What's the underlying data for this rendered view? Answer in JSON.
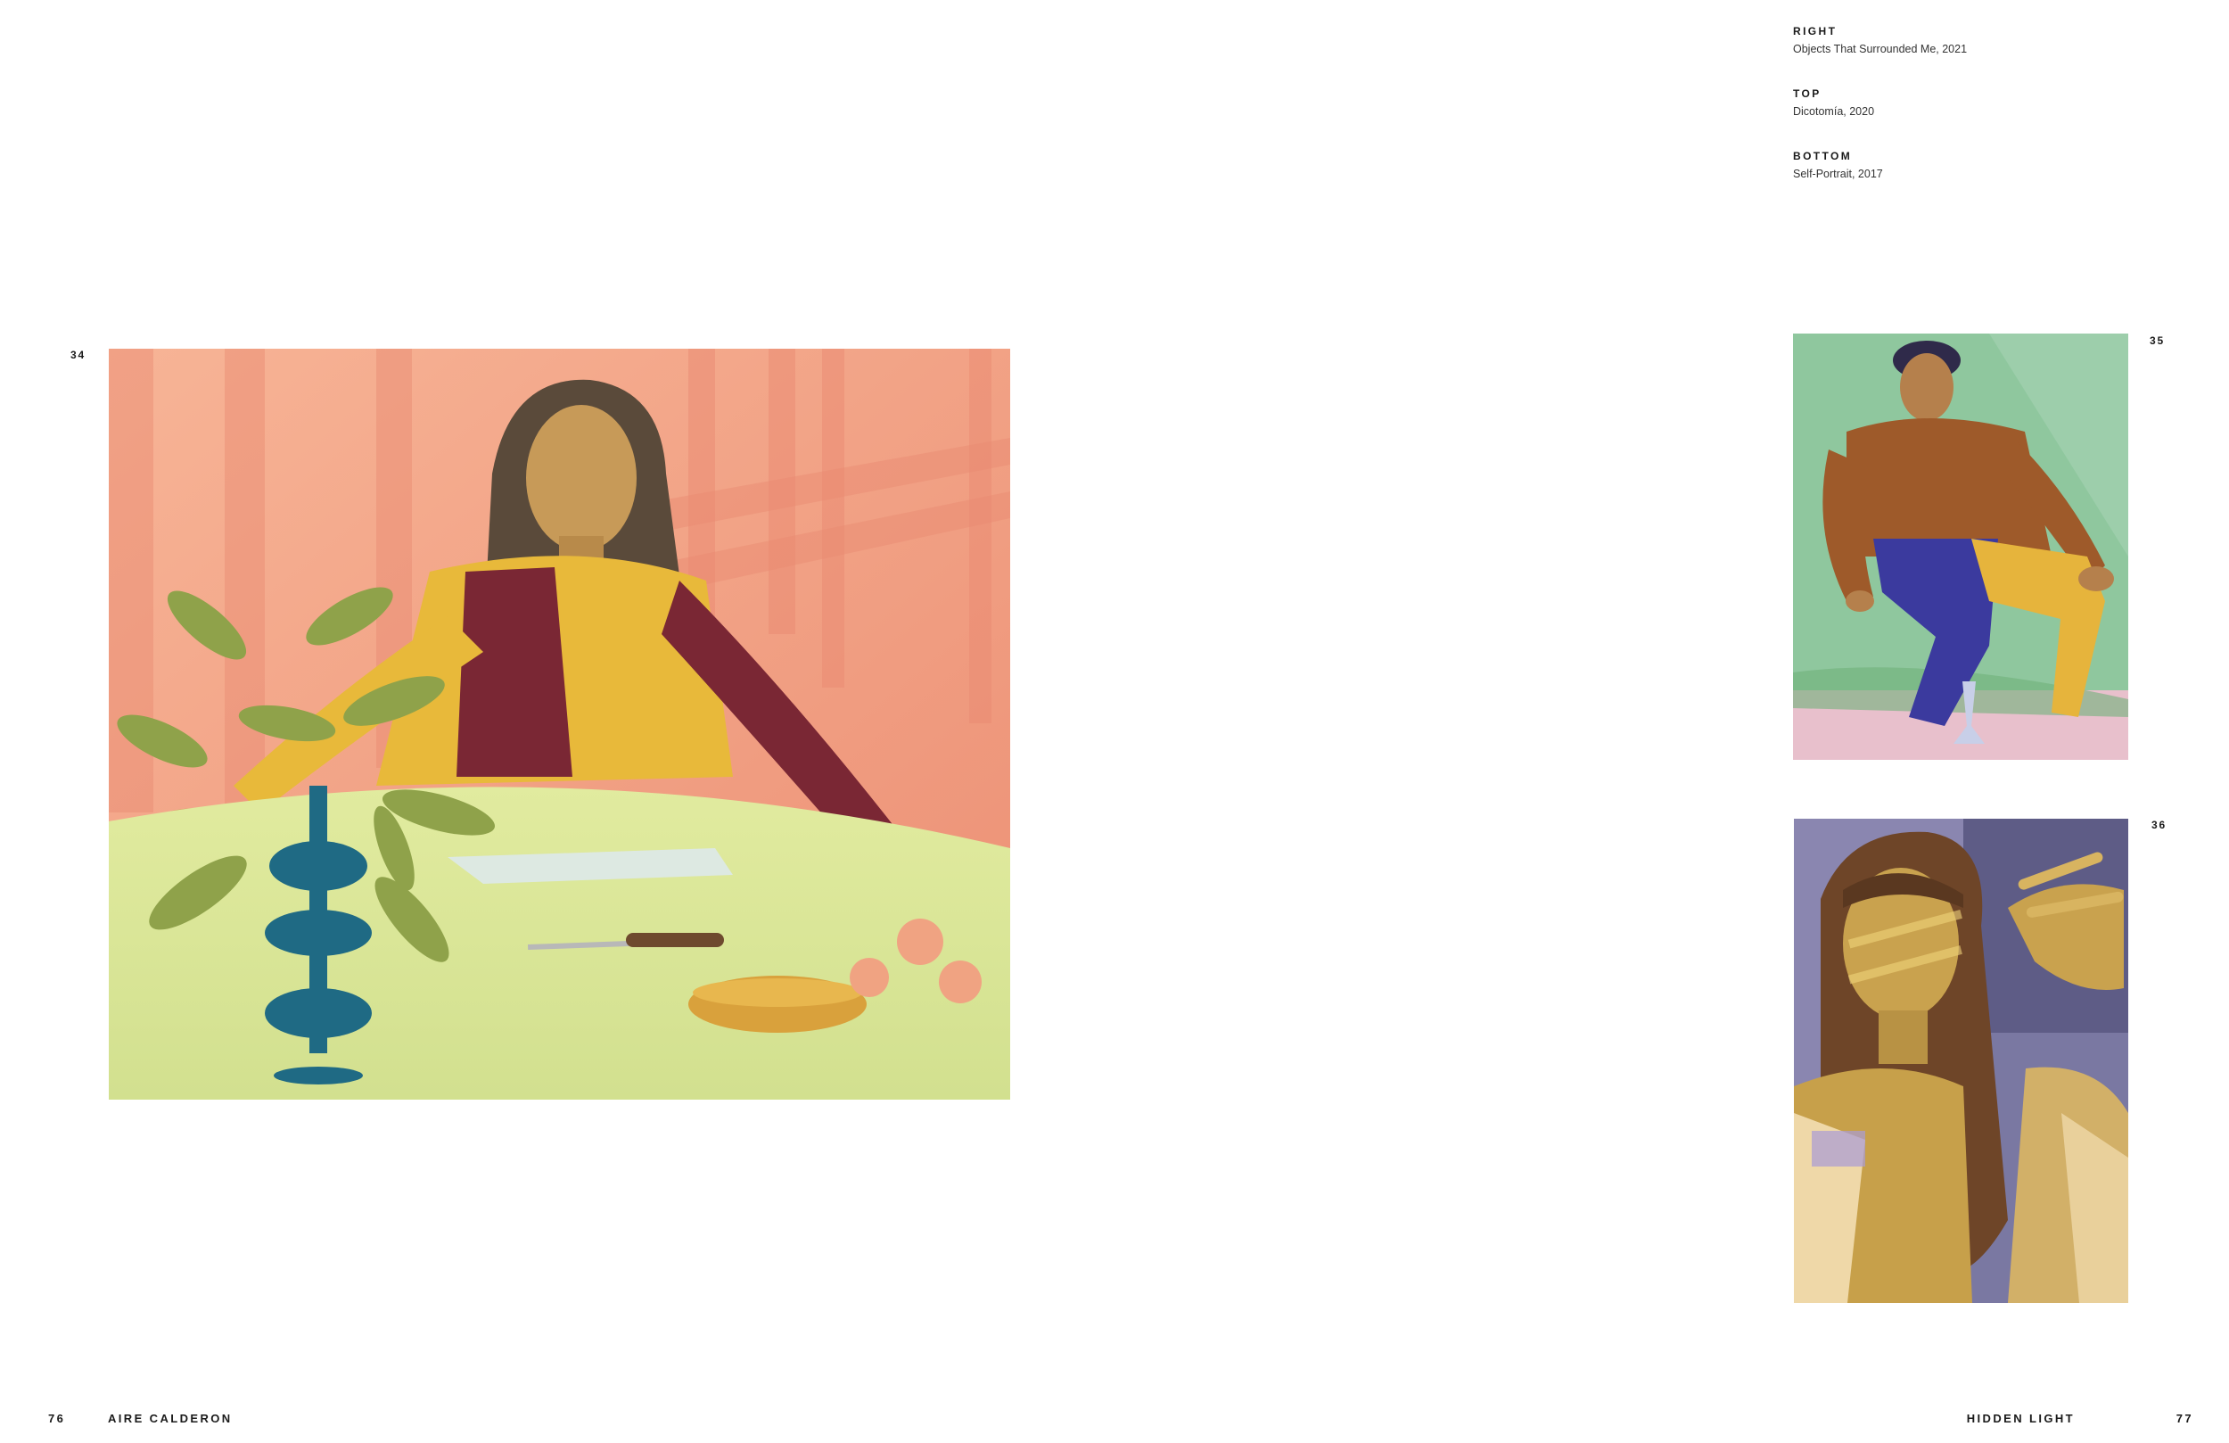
{
  "captions": [
    {
      "position": "RIGHT",
      "title": "Objects That Surrounded Me, 2021"
    },
    {
      "position": "TOP",
      "title": "Dicotomía, 2020"
    },
    {
      "position": "BOTTOM",
      "title": "Self-Portrait, 2017"
    }
  ],
  "plates": {
    "left": "34",
    "top_right": "35",
    "bottom_right": "36"
  },
  "footer": {
    "left_page_number": "76",
    "left_running_title": "AIRE CALDERON",
    "right_running_title": "HIDDEN LIGHT",
    "right_page_number": "77"
  },
  "colors": {
    "page_background": "#ffffff",
    "text": "#1a1a1a",
    "painting_34_wall": "#f2a384",
    "painting_34_table": "#d8e598",
    "painting_35_background": "#8fc79e",
    "painting_36_background": "#7a78a2"
  }
}
